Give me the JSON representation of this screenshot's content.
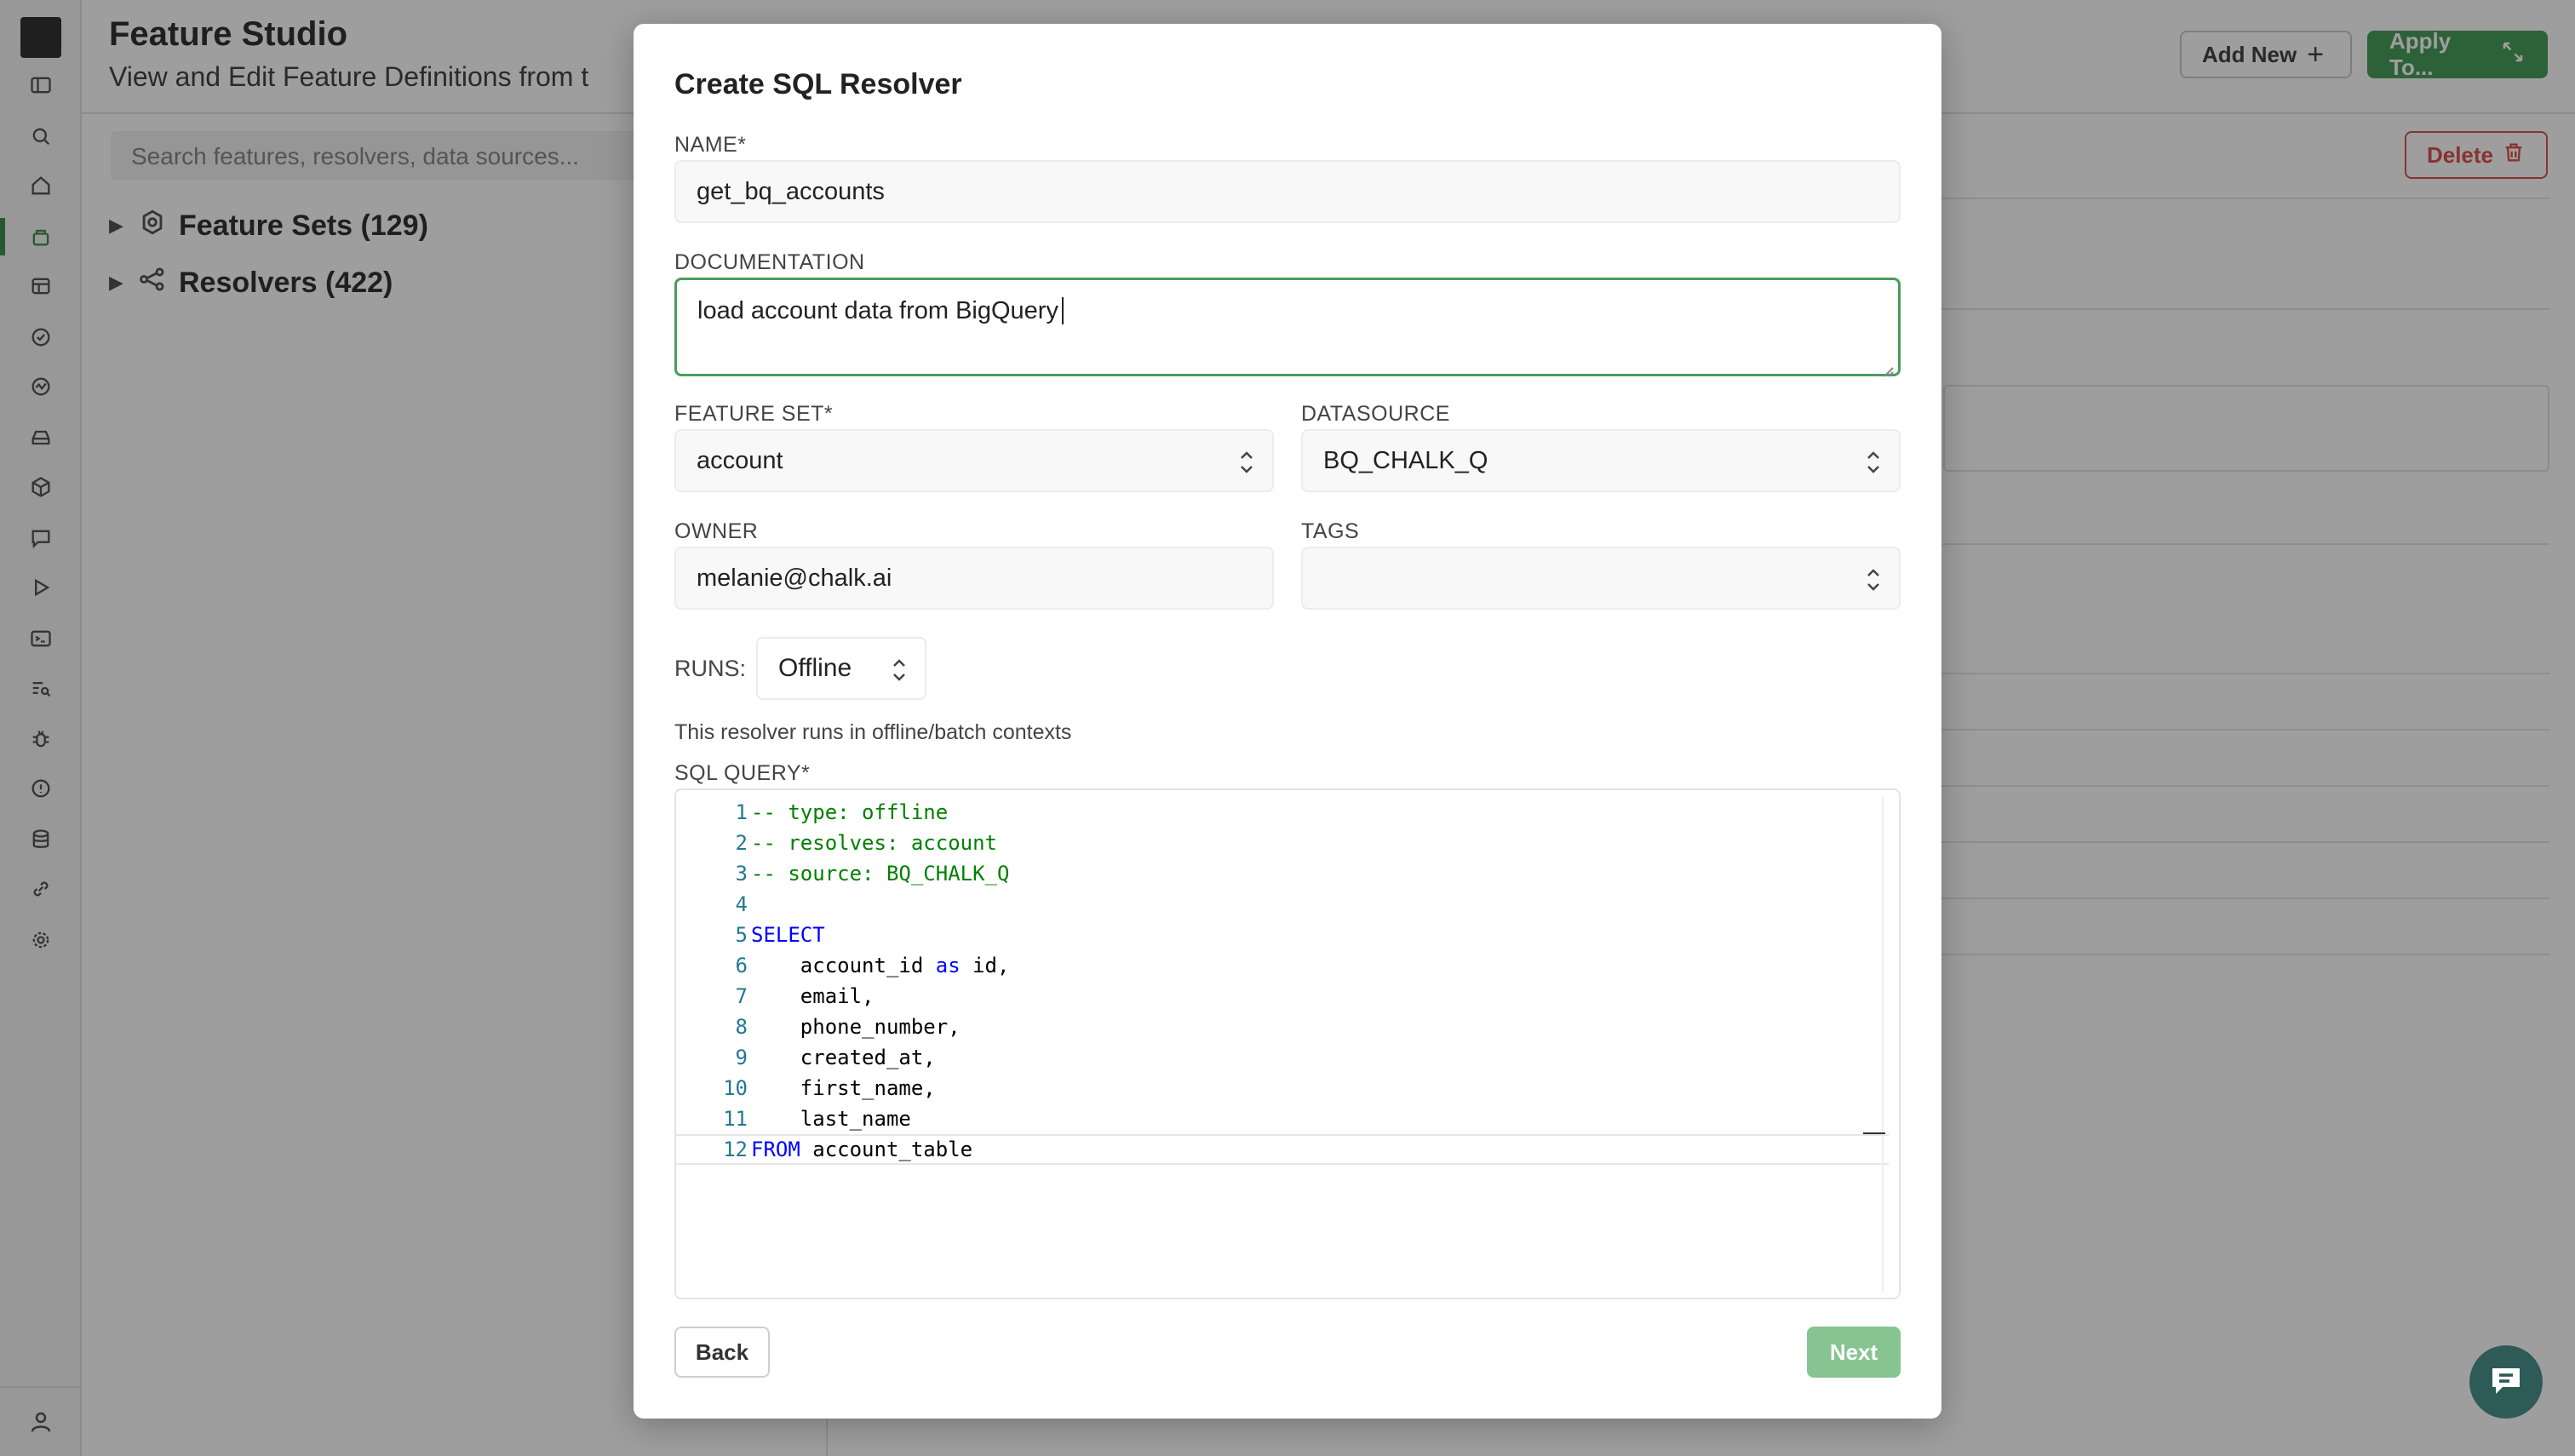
{
  "app": {
    "title": "Feature Studio",
    "subtitle": "View and Edit Feature Definitions from t",
    "add_new_label": "Add New",
    "apply_label": "Apply To...",
    "search_placeholder": "Search features, resolvers, data sources...",
    "delete_label": "Delete",
    "tree": [
      {
        "label": "Feature Sets (129)",
        "icon": "gear-icon"
      },
      {
        "label": "Resolvers (422)",
        "icon": "share-nodes-icon"
      }
    ]
  },
  "modal": {
    "title": "Create SQL Resolver",
    "name": {
      "label": "NAME*",
      "value": "get_bq_accounts"
    },
    "documentation": {
      "label": "DOCUMENTATION",
      "value": "load account data from BigQuery"
    },
    "feature_set": {
      "label": "FEATURE SET*",
      "value": "account"
    },
    "datasource": {
      "label": "DATASOURCE",
      "value": "BQ_CHALK_Q"
    },
    "owner": {
      "label": "OWNER",
      "value": "melanie@chalk.ai"
    },
    "tags": {
      "label": "TAGS",
      "value": ""
    },
    "runs": {
      "label": "RUNS:",
      "value": "Offline",
      "help": "This resolver runs in offline/batch contexts"
    },
    "sql_query": {
      "label": "SQL QUERY*",
      "lines": [
        {
          "n": "1",
          "parts": [
            {
              "t": "-- type: offline",
              "c": "cm"
            }
          ]
        },
        {
          "n": "2",
          "parts": [
            {
              "t": "-- resolves: account",
              "c": "cm"
            }
          ]
        },
        {
          "n": "3",
          "parts": [
            {
              "t": "-- source: BQ_CHALK_Q",
              "c": "cm"
            }
          ]
        },
        {
          "n": "4",
          "parts": []
        },
        {
          "n": "5",
          "parts": [
            {
              "t": "SELECT",
              "c": "kw"
            }
          ]
        },
        {
          "n": "6",
          "parts": [
            {
              "t": "    account_id ",
              "c": "txt"
            },
            {
              "t": "as",
              "c": "kw"
            },
            {
              "t": " id,",
              "c": "txt"
            }
          ]
        },
        {
          "n": "7",
          "parts": [
            {
              "t": "    email,",
              "c": "txt"
            }
          ]
        },
        {
          "n": "8",
          "parts": [
            {
              "t": "    phone_number,",
              "c": "txt"
            }
          ]
        },
        {
          "n": "9",
          "parts": [
            {
              "t": "    created_at,",
              "c": "txt"
            }
          ]
        },
        {
          "n": "10",
          "parts": [
            {
              "t": "    first_name,",
              "c": "txt"
            }
          ]
        },
        {
          "n": "11",
          "parts": [
            {
              "t": "    last_name",
              "c": "txt"
            }
          ]
        },
        {
          "n": "12",
          "parts": [
            {
              "t": "FROM",
              "c": "kw"
            },
            {
              "t": " account_table",
              "c": "txt"
            }
          ]
        }
      ]
    },
    "back_label": "Back",
    "next_label": "Next"
  },
  "colors": {
    "accent": "#4a9d5b",
    "next_disabled": "#86c492",
    "danger": "#d9534f",
    "chat": "#2e5a57"
  }
}
